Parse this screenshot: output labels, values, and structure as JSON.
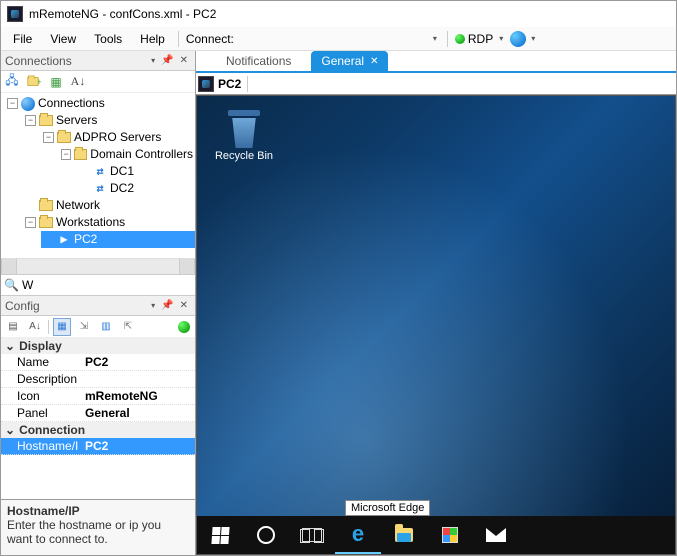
{
  "window": {
    "title": "mRemoteNG - confCons.xml - PC2"
  },
  "menu": {
    "file": "File",
    "view": "View",
    "tools": "Tools",
    "help": "Help",
    "connect_label": "Connect:",
    "protocol": "RDP"
  },
  "connections_pane": {
    "title": "Connections",
    "search_value": "W",
    "tree": {
      "root": "Connections",
      "servers": "Servers",
      "adpro": "ADPRO Servers",
      "dcs": "Domain Controllers",
      "dc1": "DC1",
      "dc2": "DC2",
      "network": "Network",
      "workstations": "Workstations",
      "pc2": "PC2"
    }
  },
  "config_pane": {
    "title": "Config",
    "categories": {
      "display": "Display",
      "connection": "Connection"
    },
    "props": {
      "name_label": "Name",
      "name_value": "PC2",
      "description_label": "Description",
      "description_value": "",
      "icon_label": "Icon",
      "icon_value": "mRemoteNG",
      "panel_label": "Panel",
      "panel_value": "General",
      "hostname_label": "Hostname/I",
      "hostname_value": "PC2"
    },
    "help_title": "Hostname/IP",
    "help_text": "Enter the hostname or ip you want to connect to."
  },
  "tabs": {
    "notifications": "Notifications",
    "general": "General"
  },
  "session": {
    "address_title": "PC2",
    "recycle_bin": "Recycle Bin",
    "tooltip": "Microsoft Edge"
  }
}
